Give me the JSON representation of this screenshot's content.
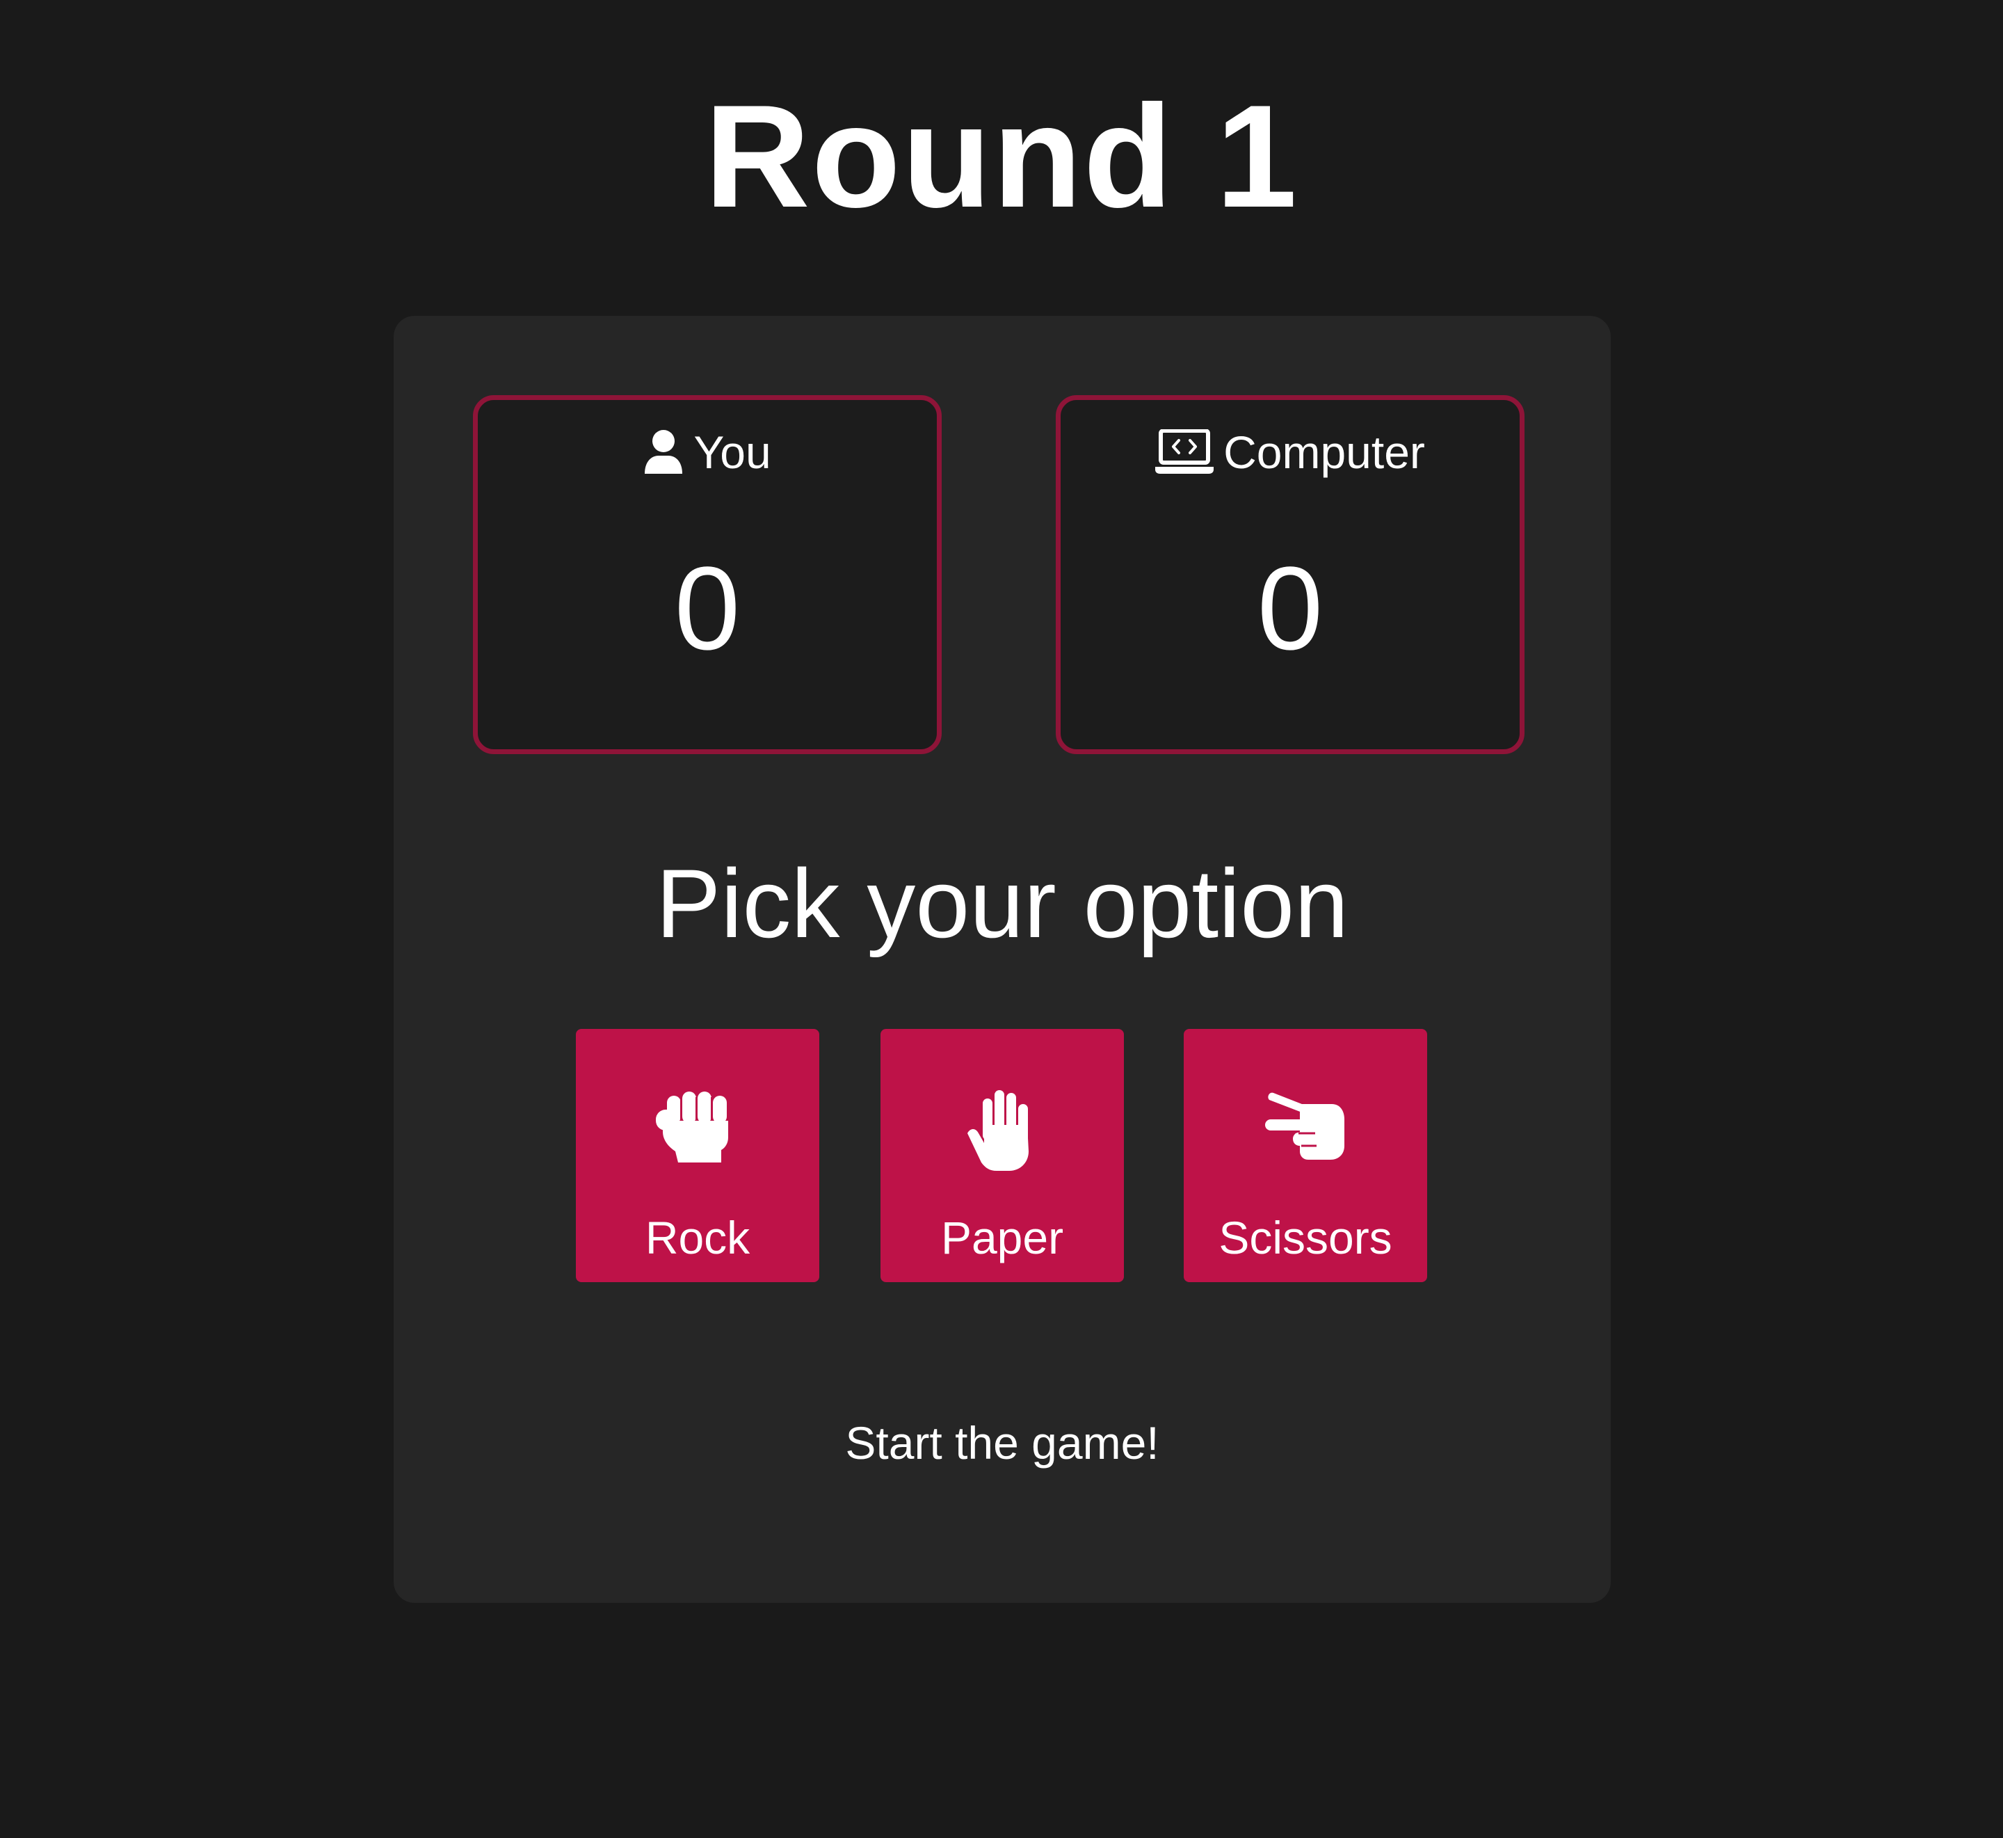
{
  "header": {
    "round_title": "Round 1"
  },
  "scoreboard": {
    "player": {
      "label": "You",
      "score": "0",
      "icon": "user-icon"
    },
    "computer": {
      "label": "Computer",
      "score": "0",
      "icon": "laptop-code-icon"
    }
  },
  "prompt": "Pick your option",
  "options": [
    {
      "label": "Rock",
      "icon": "hand-fist-icon"
    },
    {
      "label": "Paper",
      "icon": "hand-open-icon"
    },
    {
      "label": "Scissors",
      "icon": "hand-scissors-icon"
    }
  ],
  "status": "Start the game!",
  "colors": {
    "background": "#1a1a1a",
    "card": "#262626",
    "accent": "#be1248",
    "score_border": "#8e1438",
    "text": "#ffffff"
  }
}
